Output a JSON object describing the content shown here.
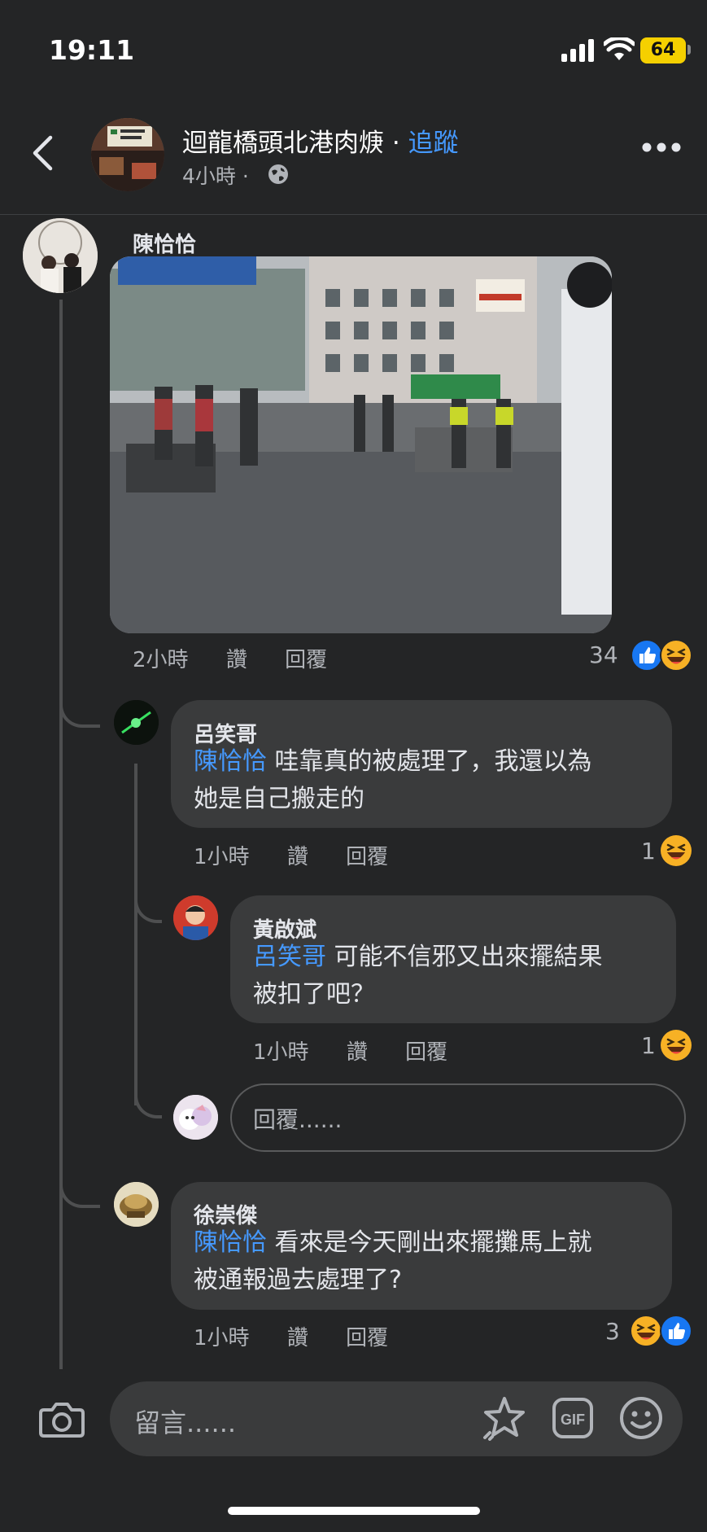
{
  "status_bar": {
    "time": "19:11",
    "battery": "64"
  },
  "header": {
    "page_name": "迴龍橋頭北港肉焿",
    "separator": " · ",
    "follow_label": "追蹤",
    "time_ago": "4小時",
    "dot": "·"
  },
  "main_comment": {
    "author": "陳恰恰",
    "time": "2小時",
    "like_label": "讚",
    "reply_label": "回覆",
    "reaction_count": "34"
  },
  "replies": [
    {
      "author": "呂笑哥",
      "mention": "陳恰恰",
      "text_line1": " 哇靠真的被處理了，我還以為",
      "text_line2": "她是自己搬走的",
      "time": "1小時",
      "like_label": "讚",
      "reply_label": "回覆",
      "reaction_count": "1"
    },
    {
      "author": "黃啟斌",
      "mention": "呂笑哥",
      "text_line1": " 可能不信邪又出來擺結果",
      "text_line2": "被扣了吧？",
      "time": "1小時",
      "like_label": "讚",
      "reply_label": "回覆",
      "reaction_count": "1"
    },
    {
      "author": "徐崇傑",
      "mention": "陳恰恰",
      "text_line1": " 看來是今天剛出來擺攤馬上就",
      "text_line2": "被通報過去處理了?",
      "time": "1小時",
      "like_label": "讚",
      "reply_label": "回覆",
      "reaction_count": "3"
    }
  ],
  "reply_input": {
    "placeholder": "回覆......"
  },
  "composer": {
    "placeholder": "留言......"
  },
  "colors": {
    "background": "#242526",
    "bubble": "#3a3b3c",
    "accent": "#4599ff",
    "muted": "#b0b3b8"
  },
  "icons": [
    "back-icon",
    "globe-icon",
    "more-icon",
    "like-reaction-icon",
    "haha-reaction-icon",
    "camera-icon",
    "sticker-icon",
    "gif-icon",
    "emoji-icon"
  ]
}
